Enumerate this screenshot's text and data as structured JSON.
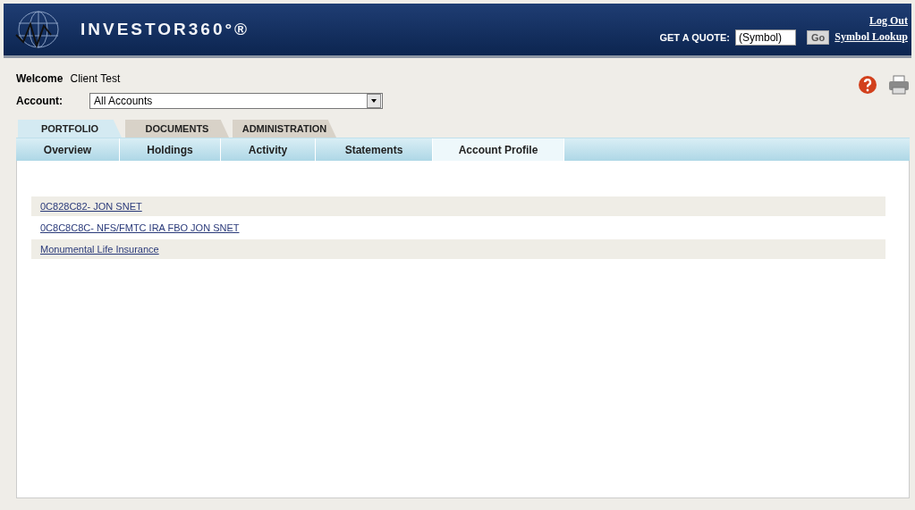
{
  "header": {
    "brand": "INVESTOR360°®",
    "log_out": "Log Out",
    "quote_label": "GET A QUOTE:",
    "quote_field": {
      "value": "(Symbol)"
    },
    "go_button": "Go",
    "symbol_lookup": "Symbol Lookup"
  },
  "welcome": {
    "label": "Welcome",
    "name": "Client Test"
  },
  "account": {
    "label": "Account:",
    "value": "All Accounts"
  },
  "tabs": [
    {
      "label": "PORTFOLIO",
      "selected": true
    },
    {
      "label": "DOCUMENTS",
      "selected": false
    },
    {
      "label": "ADMINISTRATION",
      "selected": false
    }
  ],
  "subtabs": [
    {
      "label": "Overview",
      "selected": false
    },
    {
      "label": "Holdings",
      "selected": false
    },
    {
      "label": "Activity",
      "selected": false
    },
    {
      "label": "Statements",
      "selected": false
    },
    {
      "label": "Account Profile",
      "selected": true
    }
  ],
  "accounts": [
    {
      "label": "0C828C82- JON SNET"
    },
    {
      "label": "0C8C8C8C- NFS/FMTC IRA FBO JON SNET"
    },
    {
      "label": "Monumental Life Insurance"
    }
  ]
}
